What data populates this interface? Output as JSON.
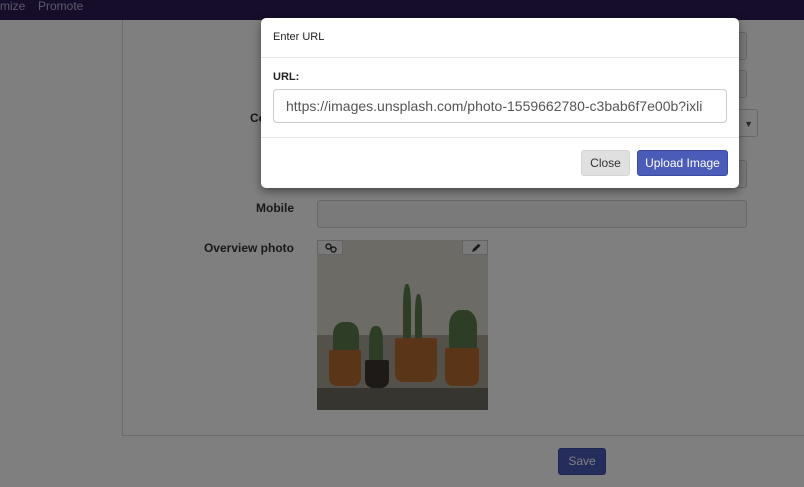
{
  "nav": {
    "customize": "mize",
    "promote": "Promote"
  },
  "form": {
    "label_co": "Co",
    "label_mobile": "Mobile",
    "label_overview_photo": "Overview photo",
    "save_label": "Save"
  },
  "icons": {
    "photo_link": "link-icon",
    "photo_edit": "pencil-icon",
    "select_caret": "caret-down-icon"
  },
  "modal": {
    "title": "Enter URL",
    "url_label": "URL:",
    "url_value": "https://images.unsplash.com/photo-1559662780-c3bab6f7e00b?ixli",
    "close_label": "Close",
    "upload_label": "Upload Image"
  },
  "colors": {
    "primary": "#4a5bb8",
    "nav_bg": "#2a1a55",
    "backdrop": "rgba(0,0,0,0.5)"
  }
}
